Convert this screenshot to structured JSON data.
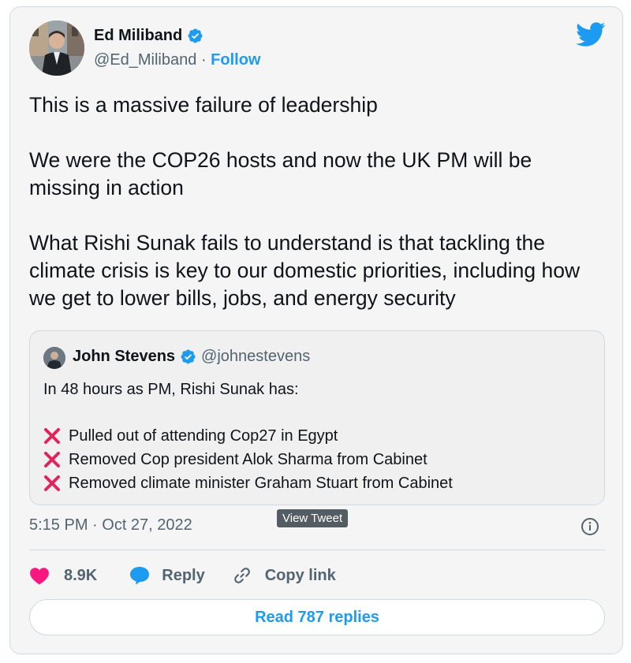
{
  "author": {
    "name": "Ed Miliband",
    "handle": "@Ed_Miliband",
    "separator": "·",
    "follow_label": "Follow"
  },
  "tweet": {
    "paragraphs": [
      "This is a massive failure of leadership",
      "We were the COP26 hosts and now the UK PM will be missing in action",
      "What Rishi Sunak fails to understand is that tackling the climate crisis is key to our domestic priorities, including how we get to lower bills, jobs, and energy security"
    ]
  },
  "quoted_tweet": {
    "name": "John Stevens",
    "handle": "@johnestevens",
    "intro": "In 48 hours as PM, Rishi Sunak has:",
    "items": [
      "Pulled out of attending Cop27 in Egypt",
      "Removed Cop president Alok Sharma from Cabinet",
      "Removed climate minister Graham Stuart from Cabinet"
    ]
  },
  "meta": {
    "timestamp": "5:15 PM · Oct 27, 2022",
    "tooltip": "View Tweet"
  },
  "actions": {
    "like_count": "8.9K",
    "reply_label": "Reply",
    "copy_link_label": "Copy link"
  },
  "footer": {
    "read_replies_label": "Read 787 replies"
  },
  "colors": {
    "accent": "#1d9bf0",
    "like": "#f91880",
    "cross": "#e0245e",
    "text": "#0f1419",
    "secondary": "#536471",
    "border": "#cfd9de"
  }
}
